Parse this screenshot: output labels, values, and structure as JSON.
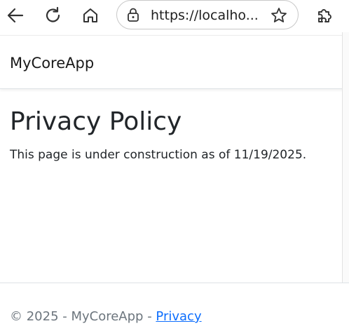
{
  "browser": {
    "url": "https://localho...",
    "icons": {
      "back": "back-arrow-icon",
      "refresh": "refresh-icon",
      "home": "home-icon",
      "lock": "lock-icon",
      "favorite": "star-icon",
      "extensions": "puzzle-piece-icon"
    }
  },
  "navbar": {
    "brand": "MyCoreApp"
  },
  "main": {
    "title": "Privacy Policy",
    "text": "This page is under construction as of 11/19/2025."
  },
  "footer": {
    "copyright": "© 2025 - MyCoreApp - ",
    "link_label": "Privacy"
  },
  "colors": {
    "text": "#212529",
    "muted": "#6c757d",
    "link": "#0d6efd"
  }
}
